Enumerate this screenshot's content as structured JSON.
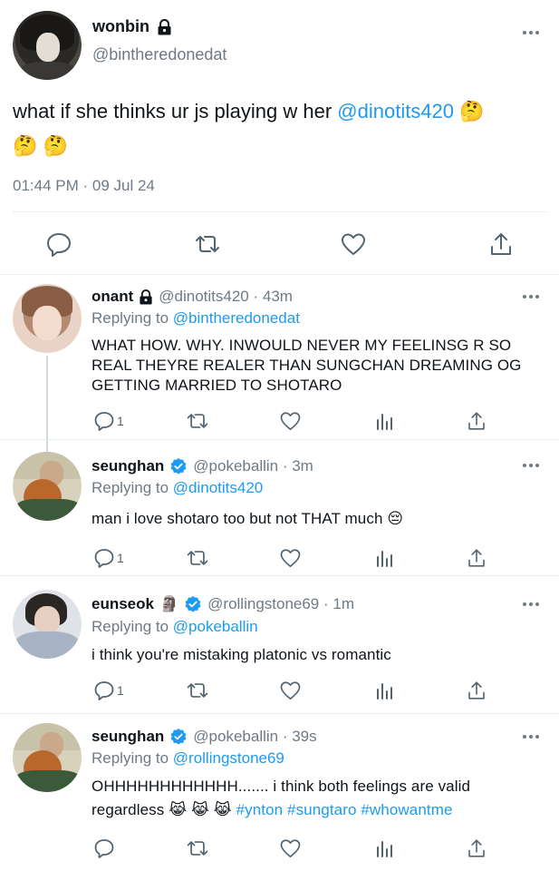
{
  "main_tweet": {
    "name": "wonbin",
    "handle": "@bintheredonedat",
    "text_plain": "what if she thinks ur js playing w her ",
    "mention": "@dinotits420",
    "emoji_inline": "🤔",
    "emoji_line2": "🤔 🤔",
    "timestamp": "01:44 PM · 09 Jul 24"
  },
  "replies": [
    {
      "name": "onant",
      "lock": true,
      "verified": false,
      "handle_time": "@dinotits420 · 43m",
      "replying_prefix": "Replying to ",
      "replying_to": "@bintheredonedat",
      "text_lines": [
        "WHAT HOW. WHY. INWOULD NEVER MY FEELINSG R SO",
        "REAL THEYRE REALER THAN SUNGCHAN DREAMING OG",
        "GETTING MARRIED TO SHOTARO"
      ],
      "reply_count": "1"
    },
    {
      "name": "seunghan",
      "lock": false,
      "verified": true,
      "handle_time": "@pokeballin · 3m",
      "replying_prefix": "Replying to ",
      "replying_to": "@dinotits420",
      "text": "man i love shotaro too but not THAT much 😔",
      "reply_count": "1"
    },
    {
      "name": "eunseok",
      "name_emoji": "🗿",
      "lock": false,
      "verified": true,
      "handle_time": "@rollingstone69 · 1m",
      "replying_prefix": "Replying to ",
      "replying_to": "@pokeballin",
      "text": "i think you're mistaking platonic vs romantic",
      "reply_count": "1"
    },
    {
      "name": "seunghan",
      "lock": false,
      "verified": true,
      "handle_time": "@pokeballin · 39s",
      "replying_prefix": "Replying to ",
      "replying_to": "@rollingstone69",
      "text_line1": "OHHHHHHHHHHHH....... i think both feelings are valid",
      "text_line2_plain": "regardless 😹 😹 😹 ",
      "hashtags": "#ynton #sungtaro #whowantme",
      "reply_count": ""
    }
  ],
  "icons": [
    "lock-icon",
    "verified-icon",
    "more-icon",
    "reply-icon",
    "retweet-icon",
    "like-icon",
    "views-icon",
    "share-icon"
  ],
  "colors": {
    "link": "#1d9bf0",
    "secondary": "#6f7a85",
    "text": "#0f1419",
    "divider": "#e6ecf0"
  }
}
